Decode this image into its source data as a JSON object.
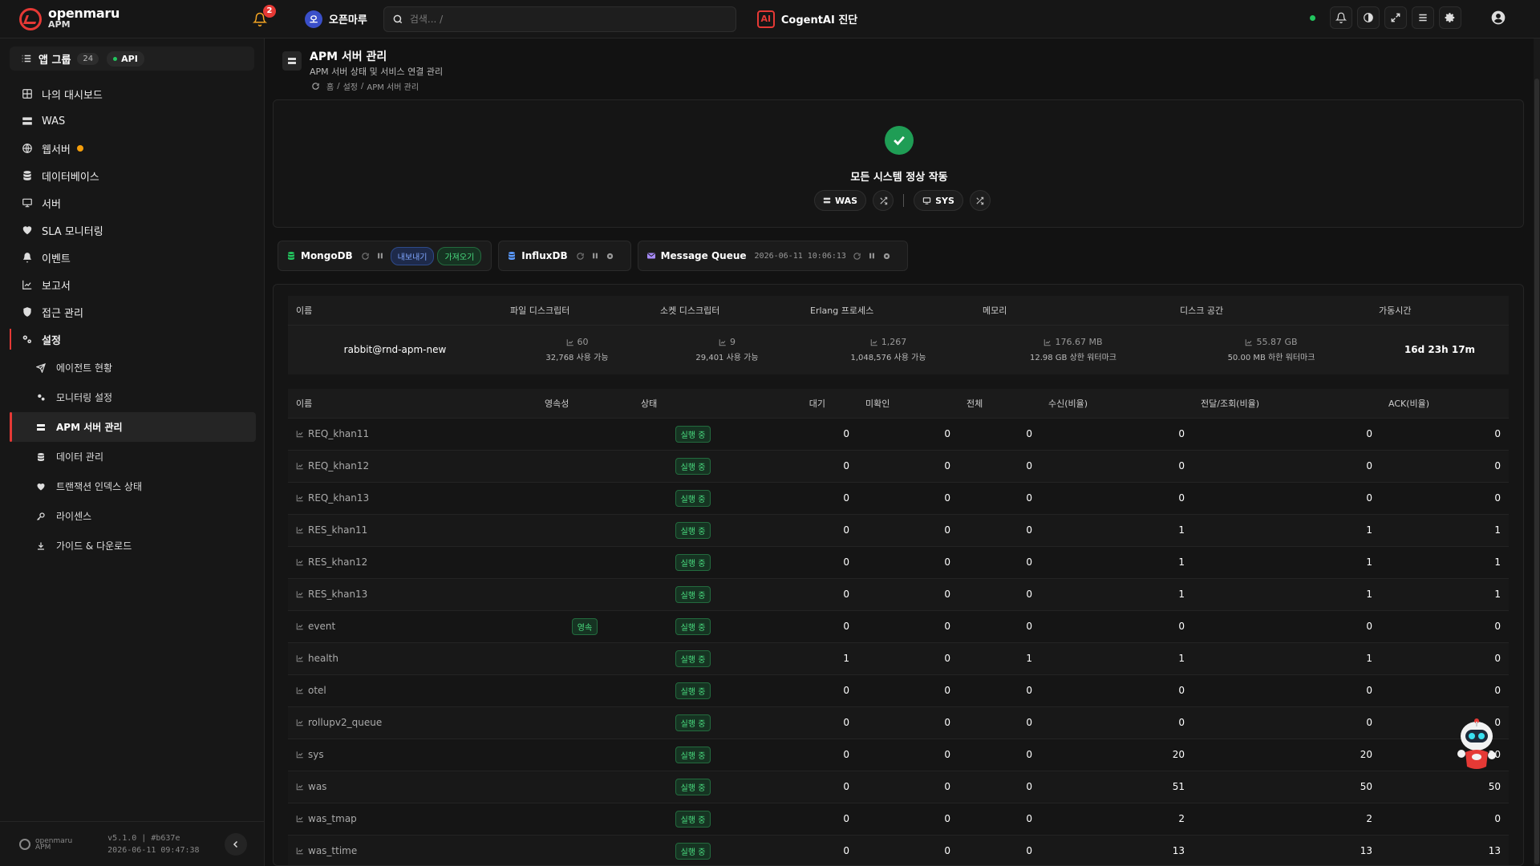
{
  "topbar": {
    "brand": "openmaru",
    "product": "APM",
    "notification_count": "2",
    "org_initial": "오",
    "org_name": "오픈마루",
    "search_placeholder": "검색... /",
    "cogent_icon": "AI",
    "cogent_label": "CogentAI 진단",
    "status_color": "#22c55e"
  },
  "sidebar": {
    "app_group_label": "앱 그룹",
    "app_group_count": "24",
    "api_label": "API",
    "items": [
      {
        "label": "나의 대시보드",
        "icon": "dashboard-icon"
      },
      {
        "label": "WAS",
        "icon": "server-stack-icon"
      },
      {
        "label": "웹서버",
        "icon": "globe-icon",
        "warning": true
      },
      {
        "label": "데이터베이스",
        "icon": "database-icon"
      },
      {
        "label": "서버",
        "icon": "monitor-icon"
      },
      {
        "label": "SLA 모니터링",
        "icon": "heart-pulse-icon"
      },
      {
        "label": "이벤트",
        "icon": "bell-icon"
      },
      {
        "label": "보고서",
        "icon": "chart-icon"
      },
      {
        "label": "접근 관리",
        "icon": "shield-icon"
      },
      {
        "label": "설정",
        "icon": "gears-icon"
      }
    ],
    "sub_items": [
      {
        "label": "에이전트 현황",
        "icon": "send-icon"
      },
      {
        "label": "모니터링 설정",
        "icon": "gears-icon"
      },
      {
        "label": "APM 서버 관리",
        "icon": "server-stack-icon",
        "active": true
      },
      {
        "label": "데이터 관리",
        "icon": "database-icon"
      },
      {
        "label": "트랜잭션 인덱스 상태",
        "icon": "heart-pulse-icon"
      },
      {
        "label": "라이센스",
        "icon": "key-icon"
      },
      {
        "label": "가이드 & 다운로드",
        "icon": "download-icon"
      }
    ],
    "footer": {
      "logo_text": "openmaru",
      "logo_sub": "APM",
      "version": "v5.1.0 | #b637e",
      "build_time": "2026-06-11 09:47:38"
    }
  },
  "page": {
    "title": "APM 서버 관리",
    "subtitle": "APM 서버 상태 및 서비스 연결 관리",
    "breadcrumb": [
      "홈",
      "/",
      "설정",
      "/",
      "APM 서버 관리"
    ]
  },
  "status": {
    "message": "모든 시스템 정상 작동",
    "pill_was": "WAS",
    "pill_sys": "SYS",
    "ok_color": "#1f9d55"
  },
  "services": {
    "mongodb": {
      "name": "MongoDB",
      "export": "내보내기",
      "import": "가져오기"
    },
    "influxdb": {
      "name": "InfluxDB"
    },
    "mq": {
      "name": "Message Queue",
      "timestamp": "2026-06-11 10:06:13"
    }
  },
  "nodes": {
    "headers": [
      "이름",
      "파일 디스크립터",
      "소켓 디스크립터",
      "Erlang 프로세스",
      "메모리",
      "디스크 공간",
      "가동시간"
    ],
    "row": {
      "name": "rabbit@rnd-apm-new",
      "fd_value": "60",
      "fd_label": "32,768 사용 가능",
      "sock_value": "9",
      "sock_label": "29,401 사용 가능",
      "erl_value": "1,267",
      "erl_label": "1,048,576 사용 가능",
      "mem_value": "176.67 MB",
      "mem_label": "12.98 GB 상한 워터마크",
      "disk_value": "55.87 GB",
      "disk_label": "50.00 MB 하한 워터마크",
      "uptime": "16d 23h 17m"
    }
  },
  "queues": {
    "headers": [
      "이름",
      "영속성",
      "상태",
      "대기",
      "미확인",
      "전체",
      "수신(비율)",
      "전달/조회(비율)",
      "ACK(비율)"
    ],
    "status_label": "실행 중",
    "durable_label": "영속",
    "rows": [
      {
        "name": "REQ_khan11",
        "durable": false,
        "ready": "0",
        "unacked": "0",
        "total": "0",
        "incoming": "0",
        "deliver": "0",
        "ack": "0"
      },
      {
        "name": "REQ_khan12",
        "durable": false,
        "ready": "0",
        "unacked": "0",
        "total": "0",
        "incoming": "0",
        "deliver": "0",
        "ack": "0"
      },
      {
        "name": "REQ_khan13",
        "durable": false,
        "ready": "0",
        "unacked": "0",
        "total": "0",
        "incoming": "0",
        "deliver": "0",
        "ack": "0"
      },
      {
        "name": "RES_khan11",
        "durable": false,
        "ready": "0",
        "unacked": "0",
        "total": "0",
        "incoming": "1",
        "deliver": "1",
        "ack": "1"
      },
      {
        "name": "RES_khan12",
        "durable": false,
        "ready": "0",
        "unacked": "0",
        "total": "0",
        "incoming": "1",
        "deliver": "1",
        "ack": "1"
      },
      {
        "name": "RES_khan13",
        "durable": false,
        "ready": "0",
        "unacked": "0",
        "total": "0",
        "incoming": "1",
        "deliver": "1",
        "ack": "1"
      },
      {
        "name": "event",
        "durable": true,
        "ready": "0",
        "unacked": "0",
        "total": "0",
        "incoming": "0",
        "deliver": "0",
        "ack": "0"
      },
      {
        "name": "health",
        "durable": false,
        "ready": "1",
        "unacked": "0",
        "total": "1",
        "incoming": "1",
        "deliver": "1",
        "ack": "0"
      },
      {
        "name": "otel",
        "durable": false,
        "ready": "0",
        "unacked": "0",
        "total": "0",
        "incoming": "0",
        "deliver": "0",
        "ack": "0"
      },
      {
        "name": "rollupv2_queue",
        "durable": false,
        "ready": "0",
        "unacked": "0",
        "total": "0",
        "incoming": "0",
        "deliver": "0",
        "ack": "0"
      },
      {
        "name": "sys",
        "durable": false,
        "ready": "0",
        "unacked": "0",
        "total": "0",
        "incoming": "20",
        "deliver": "20",
        "ack": "20"
      },
      {
        "name": "was",
        "durable": false,
        "ready": "0",
        "unacked": "0",
        "total": "0",
        "incoming": "51",
        "deliver": "50",
        "ack": "50"
      },
      {
        "name": "was_tmap",
        "durable": false,
        "ready": "0",
        "unacked": "0",
        "total": "0",
        "incoming": "2",
        "deliver": "2",
        "ack": "0"
      },
      {
        "name": "was_ttime",
        "durable": false,
        "ready": "0",
        "unacked": "0",
        "total": "0",
        "incoming": "13",
        "deliver": "13",
        "ack": "13"
      }
    ]
  }
}
